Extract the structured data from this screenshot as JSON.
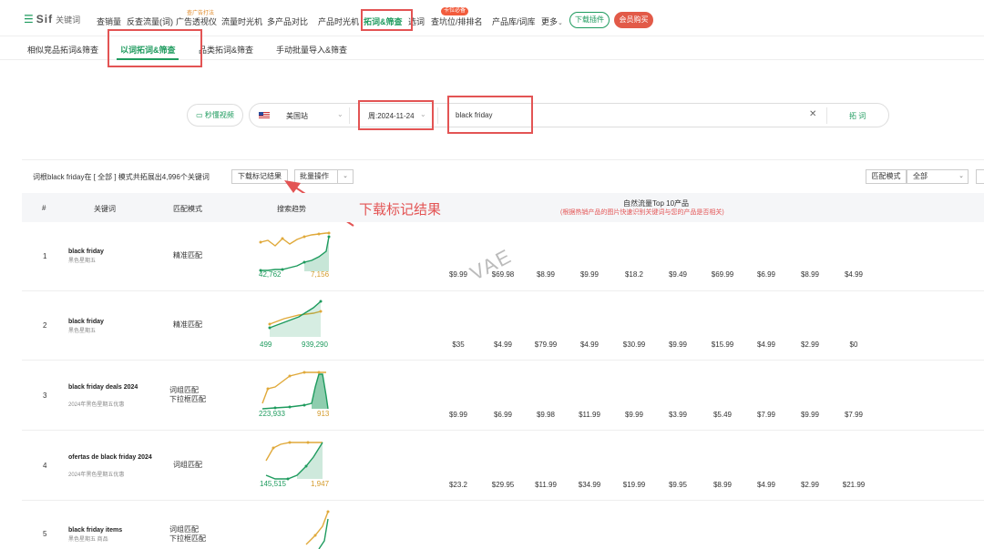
{
  "nav": {
    "logo_icon": "menu-icon",
    "logo_brand": "Sif",
    "logo_sub": "关键词",
    "items": [
      {
        "label": "查销量"
      },
      {
        "label": "反查流量(词)"
      },
      {
        "label": "广告透视仪"
      },
      {
        "label": "流量时光机"
      },
      {
        "label": "多产品对比"
      },
      {
        "label": "产品时光机"
      },
      {
        "label": "拓词&筛查"
      },
      {
        "label": "选词"
      },
      {
        "label": "查坑位/排排名"
      },
      {
        "label": "产品库/词库"
      },
      {
        "label": "更多"
      }
    ],
    "ad_tag": "查广告打法",
    "must_tag": "卡位必备",
    "plugin_button": "下载插件",
    "member_button": "会员购买"
  },
  "subnav": {
    "tabs": [
      {
        "label": "相似竞品拓词&筛查"
      },
      {
        "label": "以词拓词&筛查"
      },
      {
        "label": "品类拓词&筛查"
      },
      {
        "label": "手动批量导入&筛查"
      }
    ]
  },
  "search": {
    "video_button": "秒懂视频",
    "site": "美国站",
    "week": "周:2024-11-24",
    "keyword": "black friday",
    "search_button": "拓 词"
  },
  "results": {
    "summary": "词根black friday在 [ 全部 ] 模式共拓展出4,996个关键词",
    "download_button": "下载标记结果",
    "batch_button": "批量操作",
    "match_mode_label": "匹配模式",
    "match_mode_value": "全部",
    "annotation": "下载标记结果",
    "watermark": "VAE",
    "headers": {
      "index": "#",
      "keyword": "关键词",
      "match": "匹配模式",
      "trend": "搜索趋势",
      "top10": "自然流量Top 10产品",
      "top10_note": "(根据热销产品的图片快速识别关键词与您的产品是否相关)"
    },
    "rows": [
      {
        "index": "1",
        "keyword": "black friday",
        "keyword_cn": "黑色星期五",
        "match": [
          "精准匹配"
        ],
        "trend_left": "42,762",
        "trend_right": "7,156",
        "prices": [
          "$9.99",
          "$69.98",
          "$8.99",
          "$9.99",
          "$18.2",
          "$9.49",
          "$69.99",
          "$6.99",
          "$8.99",
          "$4.99"
        ]
      },
      {
        "index": "2",
        "keyword": "black friday",
        "keyword_cn": "黑色星期五",
        "match": [
          "精准匹配"
        ],
        "trend_left": "499",
        "trend_right": "939,290",
        "prices": [
          "$35",
          "$4.99",
          "$79.99",
          "$4.99",
          "$30.99",
          "$9.99",
          "$15.99",
          "$4.99",
          "$2.99",
          "$0"
        ]
      },
      {
        "index": "3",
        "keyword": "black friday deals 2024",
        "keyword_cn": "2024年黑色星期五优惠",
        "match": [
          "词组匹配",
          "下拉框匹配"
        ],
        "trend_left": "223,933",
        "trend_right": "913",
        "prices": [
          "$9.99",
          "$6.99",
          "$9.98",
          "$11.99",
          "$9.99",
          "$3.99",
          "$5.49",
          "$7.99",
          "$9.99",
          "$7.99"
        ]
      },
      {
        "index": "4",
        "keyword": "ofertas de black friday 2024",
        "keyword_cn": "2024年黑色星期五优惠",
        "match": [
          "词组匹配"
        ],
        "trend_left": "145,515",
        "trend_right": "1,947",
        "prices": [
          "$23.2",
          "$29.95",
          "$11.99",
          "$34.99",
          "$19.99",
          "$9.95",
          "$8.99",
          "$4.99",
          "$2.99",
          "$21.99"
        ]
      },
      {
        "index": "5",
        "keyword": "black friday items",
        "keyword_cn": "黑色星期五 商品",
        "match": [
          "词组匹配",
          "下拉框匹配"
        ],
        "trend_left": "",
        "trend_right": "",
        "prices": []
      }
    ]
  },
  "colors": {
    "brand_green": "#1e9b5e",
    "trend_orange": "#e0a93a",
    "annotation_red": "#e35454"
  }
}
